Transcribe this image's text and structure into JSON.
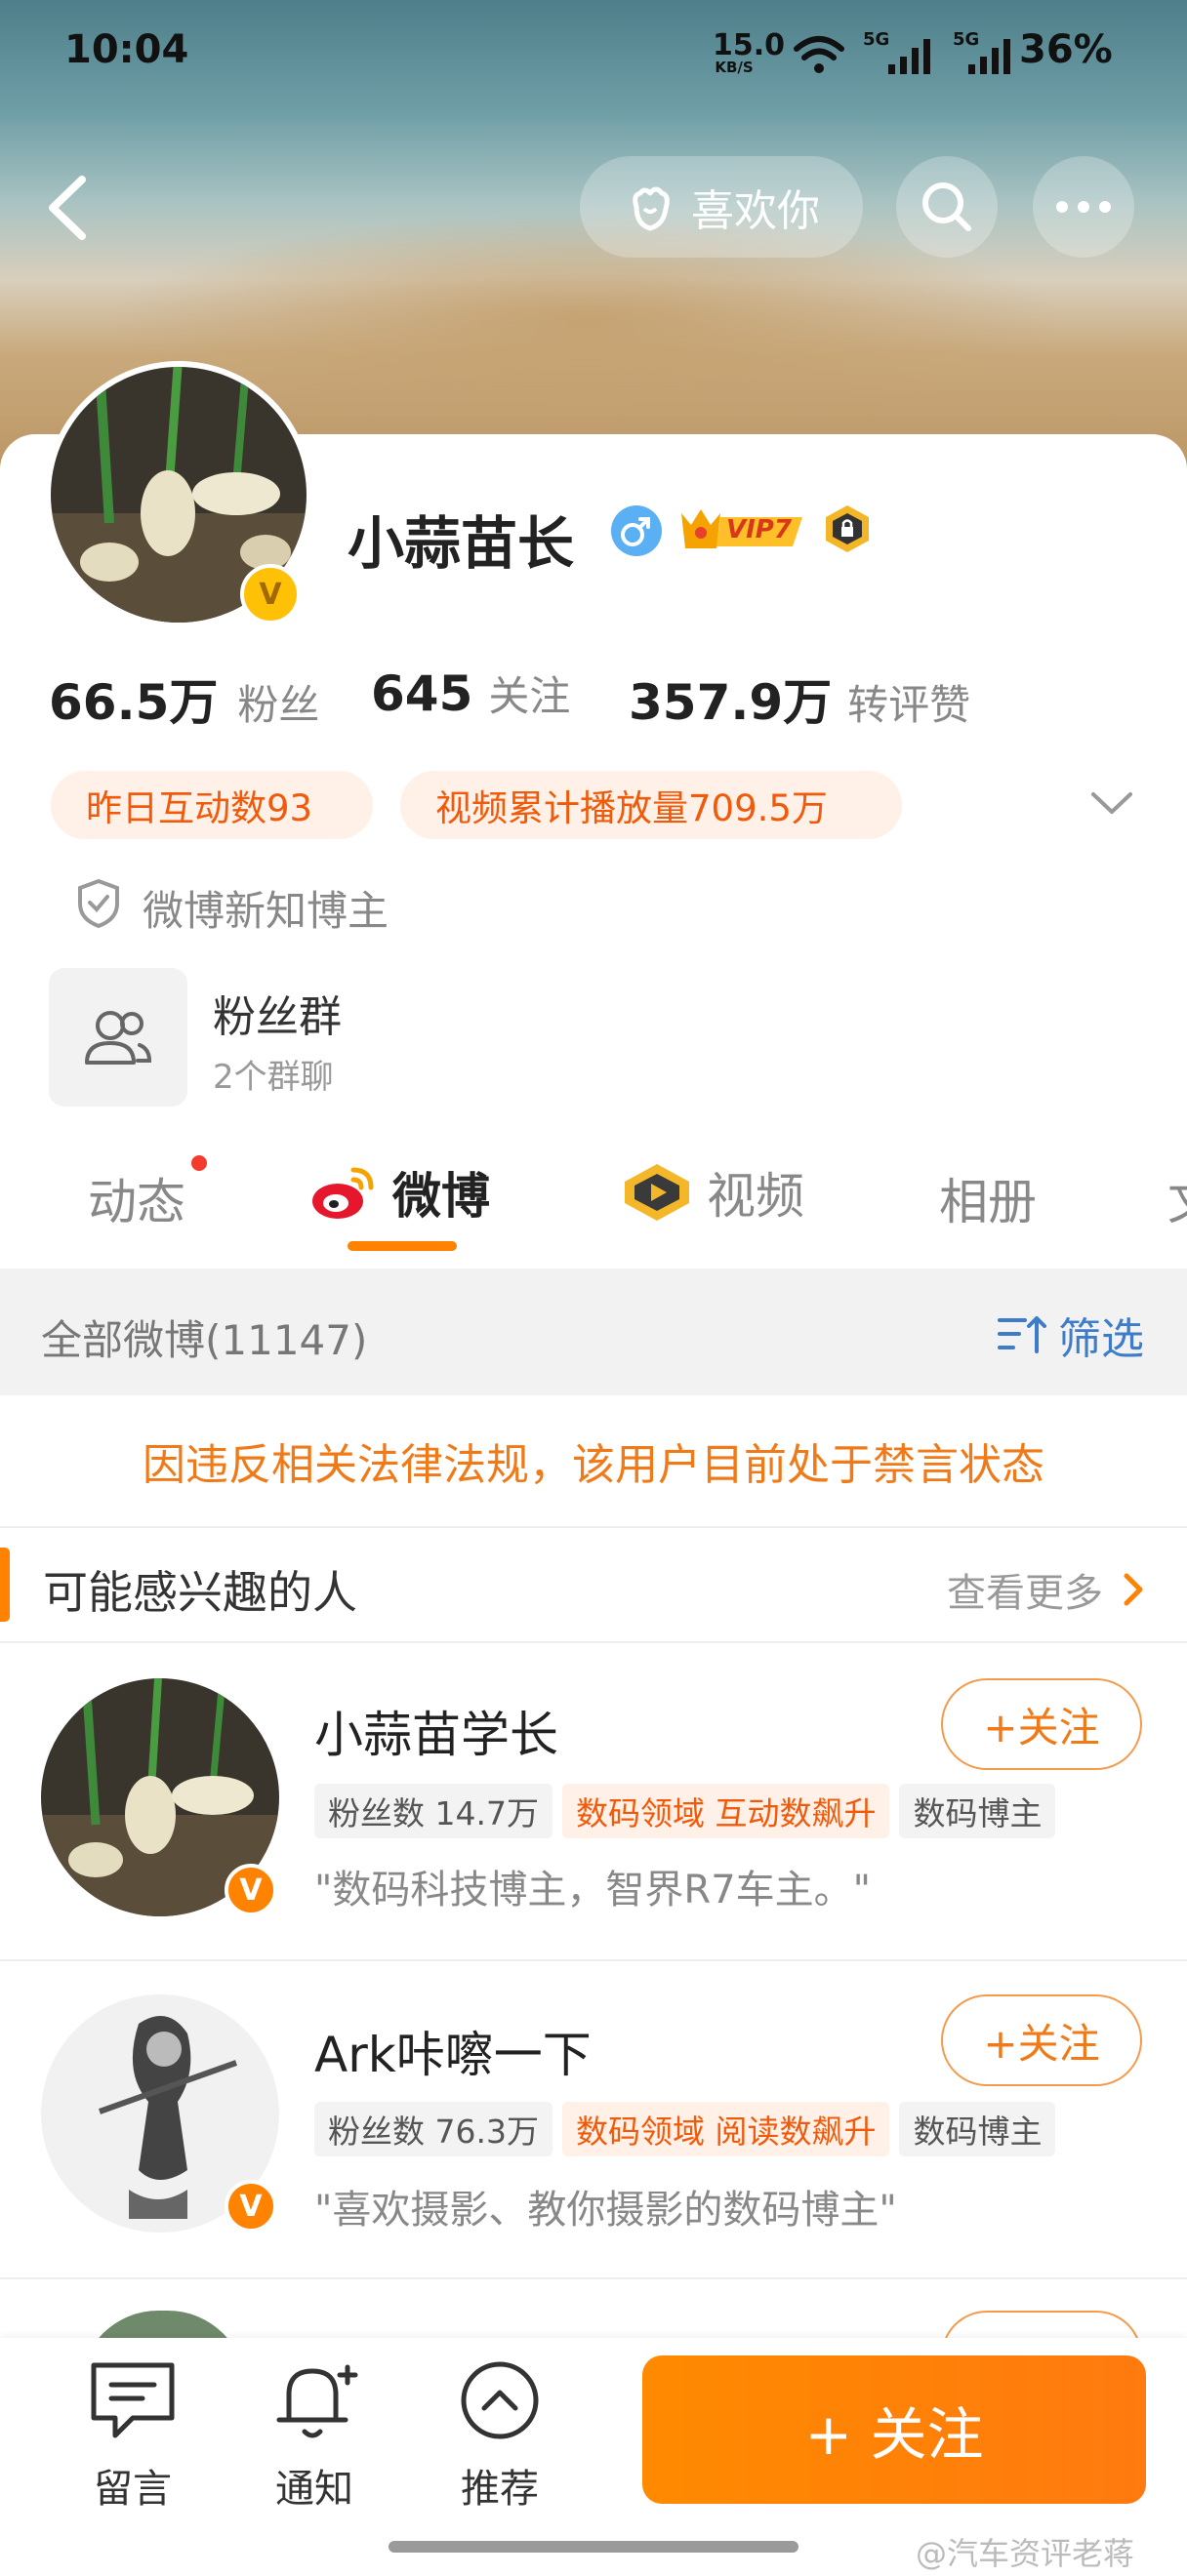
{
  "status_bar": {
    "time": "10:04",
    "net_speed_value": "15.0",
    "net_speed_unit": "KB/S",
    "signal1": "5G",
    "signal2": "5G",
    "battery": "36%"
  },
  "header": {
    "like_label": "喜欢你"
  },
  "profile": {
    "name": "小蒜苗长",
    "vip_label": "VIP7",
    "stats": [
      {
        "value": "66.5万",
        "label": "粉丝"
      },
      {
        "value": "645",
        "label": "关注"
      },
      {
        "value": "357.9万",
        "label": "转评赞"
      }
    ],
    "pills": [
      "昨日互动数93",
      "视频累计播放量709.5万"
    ],
    "certification": "微博新知博主",
    "fan_group": {
      "title": "粉丝群",
      "subtitle": "2个群聊"
    }
  },
  "tabs": [
    "动态",
    "微博",
    "视频",
    "相册",
    "文"
  ],
  "feed": {
    "filter_title": "全部微博(11147)",
    "filter_button": "筛选",
    "ban_notice": "因违反相关法律法规，该用户目前处于禁言状态"
  },
  "recommend": {
    "title": "可能感兴趣的人",
    "more": "查看更多",
    "follow_label": "+关注",
    "users": [
      {
        "name": "小蒜苗学长",
        "tags": [
          "粉丝数 14.7万",
          "数码领域 互动数飙升",
          "数码博主"
        ],
        "bio": "\"数码科技博主，智界R7车主。\""
      },
      {
        "name": "Ark咔嚓一下",
        "tags": [
          "粉丝数 76.3万",
          "数码领域 阅读数飙升",
          "数码博主"
        ],
        "bio": "\"喜欢摄影、教你摄影的数码博主\""
      }
    ]
  },
  "bottom_bar": {
    "items": [
      {
        "label": "留言",
        "icon": "message-icon"
      },
      {
        "label": "通知",
        "icon": "bell-icon"
      },
      {
        "label": "推荐",
        "icon": "chevron-up-icon"
      }
    ],
    "follow_cta": "+ 关注"
  },
  "watermark": "@汽车资评老蒋",
  "colors": {
    "accent": "#ff8200",
    "accent_text": "#f05a0a",
    "link_blue": "#3d7cc9"
  }
}
